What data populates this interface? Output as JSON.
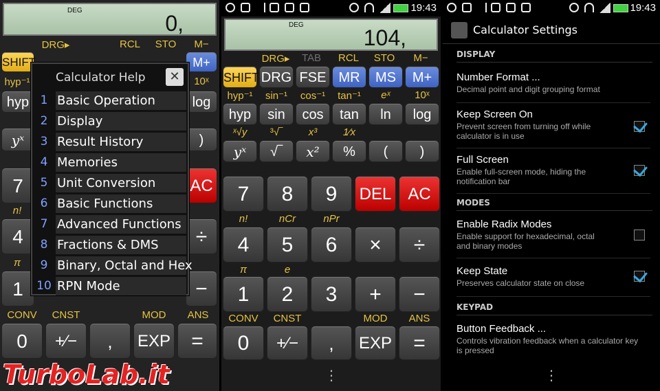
{
  "status_bar": {
    "time": "19:43"
  },
  "watermark": "TurboLab.it",
  "calc_left": {
    "mode": "DEG",
    "display": "0,"
  },
  "calc_mid": {
    "mode": "DEG",
    "display": "104,"
  },
  "labels": {
    "row1": [
      "DRG▸",
      "TAB",
      "RCL",
      "STO",
      "M−"
    ],
    "row2": [
      "hyp⁻¹",
      "sin⁻¹",
      "cos⁻¹",
      "tan⁻¹",
      "eˣ",
      "10ˣ"
    ],
    "row3": [
      "ˣ√y",
      "³√‾",
      "x³",
      "1⁄x"
    ],
    "row4": [
      "n!",
      "nCr",
      "nPr"
    ],
    "row5": [
      "π",
      "e"
    ],
    "row6": [
      "CONV",
      "CNST",
      "MOD",
      "ANS"
    ]
  },
  "keys": {
    "r1": [
      "SHIFT",
      "DRG",
      "FSE",
      "MR",
      "MS",
      "M+"
    ],
    "r2": [
      "hyp",
      "sin",
      "cos",
      "tan",
      "ln",
      "log"
    ],
    "r3": [
      "yˣ",
      "√‾",
      "x²",
      "%",
      "(",
      ")"
    ],
    "r4": [
      "7",
      "8",
      "9",
      "DEL",
      "AC"
    ],
    "r5": [
      "4",
      "5",
      "6",
      "×",
      "÷"
    ],
    "r6": [
      "1",
      "2",
      "3",
      "+",
      "−"
    ],
    "r7": [
      "0",
      "+⁄−",
      ",",
      "EXP",
      "="
    ]
  },
  "left_partial": {
    "r1": [
      "SHIFT",
      "DRG",
      "FSE",
      "MR",
      "MS",
      "M+"
    ],
    "r2lbl": "hyp⁻¹",
    "r2lblr": "10ˣ",
    "hyp": "hyp",
    "log": "log",
    "yx": "yˣ",
    "paren": ")",
    "seven": "7",
    "ac": "AC",
    "nfact": "n!",
    "four": "4",
    "div": "÷",
    "pi": "π",
    "one": "1",
    "minus": "−",
    "conv": "CONV",
    "cnst": "CNST",
    "mod": "MOD",
    "ans": "ANS",
    "zero": "0",
    "pm": "+⁄−",
    "comma": ",",
    "exp": "EXP",
    "eq": "="
  },
  "help_dialog": {
    "title": "Calculator Help",
    "close": "✕",
    "items": [
      {
        "n": "1",
        "label": "Basic Operation"
      },
      {
        "n": "2",
        "label": "Display"
      },
      {
        "n": "3",
        "label": "Result History"
      },
      {
        "n": "4",
        "label": "Memories"
      },
      {
        "n": "5",
        "label": "Unit Conversion"
      },
      {
        "n": "6",
        "label": "Basic Functions"
      },
      {
        "n": "7",
        "label": "Advanced Functions"
      },
      {
        "n": "8",
        "label": "Fractions & DMS"
      },
      {
        "n": "9",
        "label": "Binary, Octal and Hex"
      },
      {
        "n": "10",
        "label": "RPN Mode"
      }
    ]
  },
  "settings": {
    "title": "Calculator Settings",
    "sections": {
      "display": "DISPLAY",
      "modes": "MODES",
      "keypad": "KEYPAD"
    },
    "items": [
      {
        "title": "Number Format ...",
        "summary": "Decimal point and digit grouping format"
      },
      {
        "title": "Keep Screen On",
        "summary": "Prevent screen from turning off while calculator is in use",
        "checked": true
      },
      {
        "title": "Full Screen",
        "summary": "Enable full-screen mode, hiding the notification bar",
        "checked": true
      },
      {
        "title": "Enable Radix Modes",
        "summary": "Enable support for hexadecimal, octal and binary modes",
        "checked": false
      },
      {
        "title": "Keep State",
        "summary": "Preserves calculator state on close",
        "checked": true
      },
      {
        "title": "Button Feedback ...",
        "summary": "Controls vibration feedback when a calculator key is pressed"
      }
    ]
  },
  "overflow_menu": "⋮"
}
